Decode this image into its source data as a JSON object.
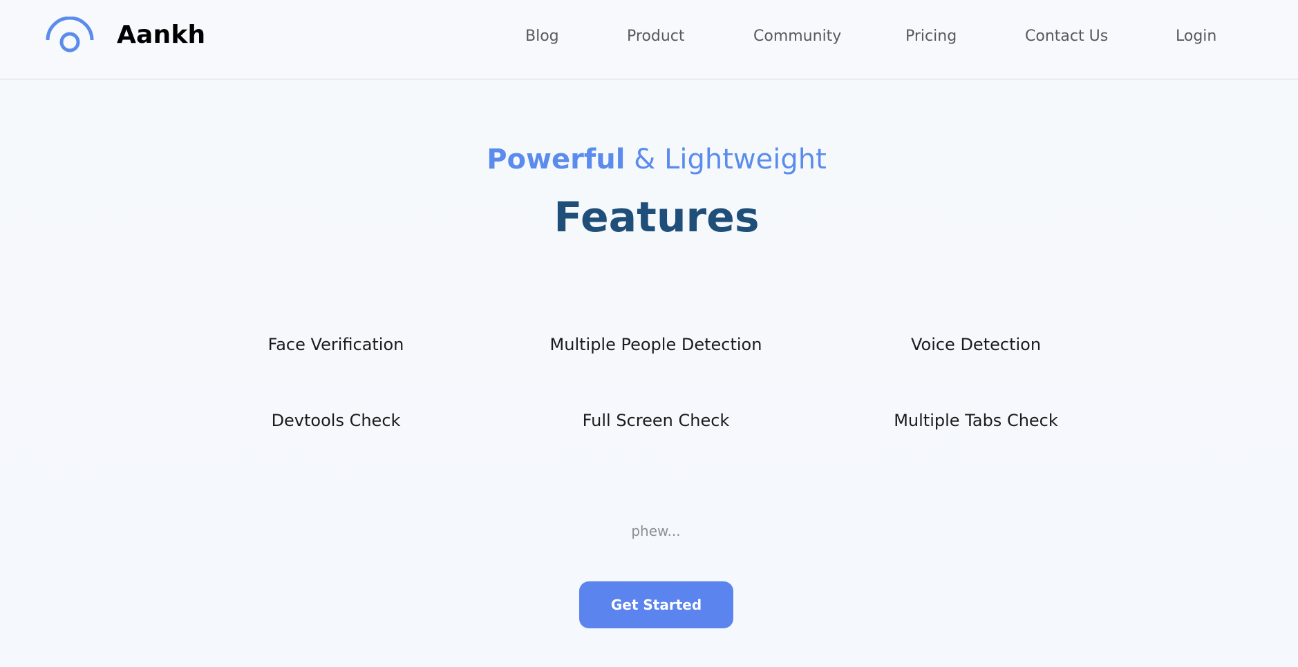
{
  "brand": {
    "name": "Aankh",
    "icon": "eye-arc-icon",
    "accent_color": "#5b8ced"
  },
  "nav": {
    "items": [
      {
        "label": "Blog"
      },
      {
        "label": "Product"
      },
      {
        "label": "Community"
      },
      {
        "label": "Pricing"
      },
      {
        "label": "Contact Us"
      },
      {
        "label": "Login"
      }
    ]
  },
  "hero": {
    "subtitle_strong": "Powerful",
    "subtitle_rest": "& Lightweight",
    "title": "Features",
    "title_color": "#1f4e79"
  },
  "features": [
    "Face Verification",
    "Multiple People Detection",
    "Voice Detection",
    "Devtools Check",
    "Full Screen Check",
    "Multiple Tabs Check"
  ],
  "footer_note": "phew...",
  "cta": {
    "label": "Get Started",
    "color": "#5b84ee"
  }
}
